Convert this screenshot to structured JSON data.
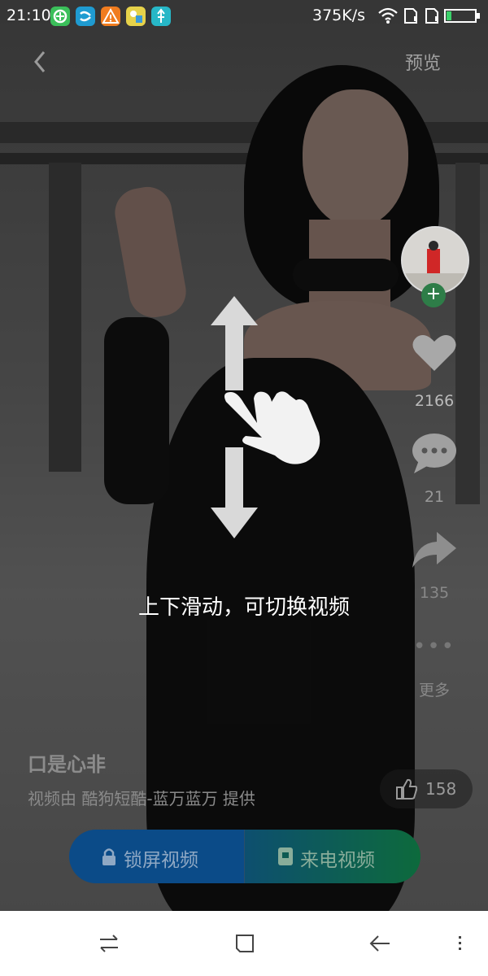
{
  "status_bar": {
    "time": "21:10",
    "network_speed": "375K/s",
    "app_icons": [
      "green-app-icon",
      "blue-app-icon",
      "warning-app-icon",
      "weather-app-icon",
      "usb-app-icon"
    ]
  },
  "top_nav": {
    "preview_label": "预览"
  },
  "actions": {
    "like_count": "2166",
    "comment_count": "21",
    "share_count": "135",
    "more_label": "更多"
  },
  "hint": {
    "text": "上下滑动，可切换视频"
  },
  "video": {
    "title": "口是心非",
    "provider": "视频由 酷狗短酷-蓝万蓝万 提供",
    "like_pill_count": "158"
  },
  "action_bar": {
    "lock_screen_label": "锁屏视频",
    "call_video_label": "来电视频"
  },
  "colors": {
    "lock_button": "#0b4b88",
    "call_button": "#0d6a3c",
    "follow_plus": "#2e7d48"
  }
}
